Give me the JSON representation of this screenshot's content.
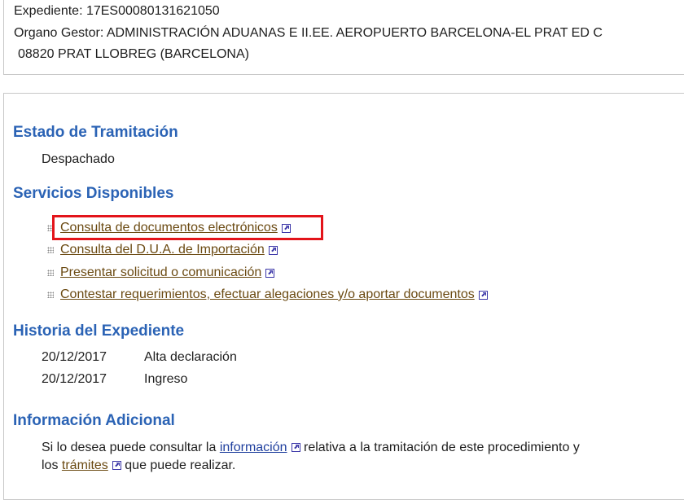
{
  "header": {
    "expediente": "Expediente: 17ES00080131621050",
    "organo": "Organo Gestor: ADMINISTRACIÓN ADUANAS E II.EE. AEROPUERTO BARCELONA-EL PRAT  ED C",
    "address": "08820 PRAT LLOBREG (BARCELONA)"
  },
  "estado": {
    "title": "Estado de Tramitación",
    "value": "Despachado"
  },
  "servicios": {
    "title": "Servicios Disponibles",
    "items": [
      {
        "label": "Consulta de documentos electrónicos"
      },
      {
        "label": "Consulta del D.U.A. de Importación"
      },
      {
        "label": "Presentar solicitud o comunicación"
      },
      {
        "label": "Contestar requerimientos, efectuar alegaciones y/o aportar documentos"
      }
    ]
  },
  "historia": {
    "title": "Historia del Expediente",
    "rows": [
      {
        "date": "20/12/2017",
        "event": "Alta declaración"
      },
      {
        "date": "20/12/2017",
        "event": "Ingreso"
      }
    ]
  },
  "info": {
    "title": "Información Adicional",
    "text_pre": "Si lo desea puede consultar la",
    "link1": "información",
    "text_mid": "relativa a la tramitación de este procedimiento y",
    "text_pre2": "los",
    "link2": "trámites",
    "text_post": "que puede realizar."
  },
  "colors": {
    "heading": "#2b63b5",
    "link": "#6b4a12",
    "highlight": "#e3141a"
  }
}
